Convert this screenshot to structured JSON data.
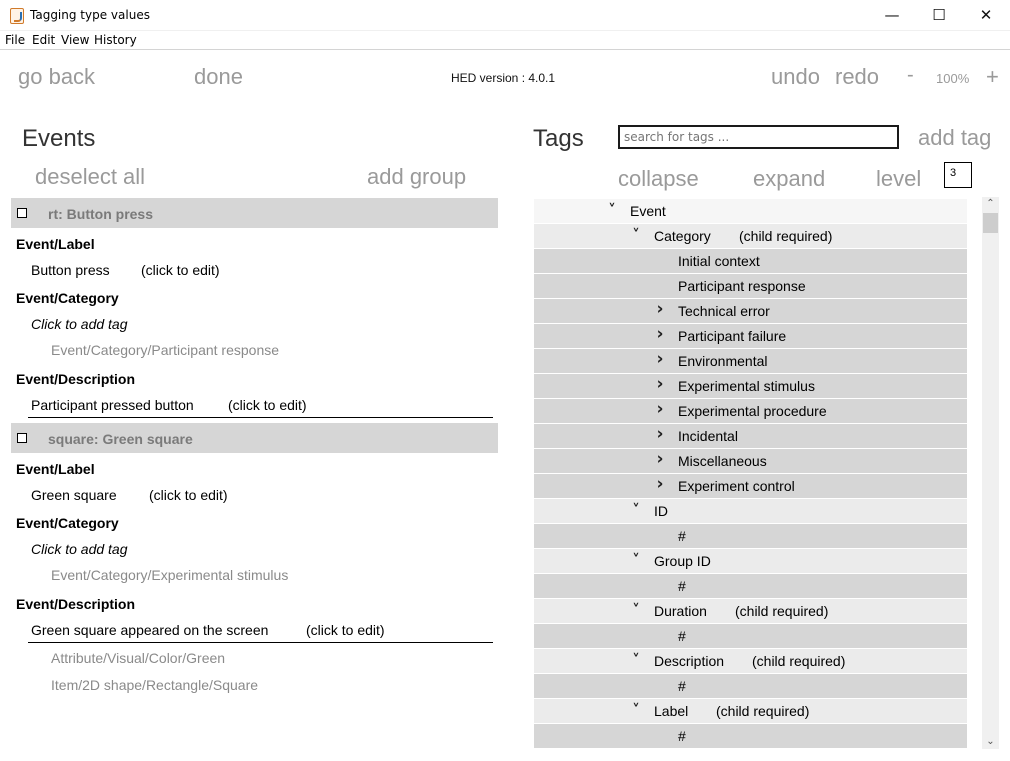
{
  "window": {
    "title": "Tagging type values",
    "minimize_glyph": "—",
    "maximize_glyph": "☐",
    "close_glyph": "✕"
  },
  "menu": [
    "File",
    "Edit",
    "View",
    "History"
  ],
  "toolbar": {
    "go_back": "go back",
    "done": "done",
    "hed_version": "HED version : 4.0.1",
    "undo": "undo",
    "redo": "redo",
    "zoom_out": "-",
    "zoom_level": "100%",
    "zoom_in": "+"
  },
  "events": {
    "title": "Events",
    "deselect_all": "deselect all",
    "add_group": "add group",
    "items": [
      {
        "title": "rt: Button press",
        "label_heading": "Event/Label",
        "label_value": "Button press",
        "label_edit": "(click to edit)",
        "category_heading": "Event/Category",
        "add_tag": "Click to add tag",
        "category_tags": [
          "Event/Category/Participant response"
        ],
        "description_heading": "Event/Description",
        "description_value": "Participant pressed button",
        "description_edit": "(click to edit)",
        "extra_tags": []
      },
      {
        "title": "square: Green square",
        "label_heading": "Event/Label",
        "label_value": "Green square",
        "label_edit": "(click to edit)",
        "category_heading": "Event/Category",
        "add_tag": "Click to add tag",
        "category_tags": [
          "Event/Category/Experimental stimulus"
        ],
        "description_heading": "Event/Description",
        "description_value": "Green square appeared on the screen",
        "description_edit": "(click to edit)",
        "extra_tags": [
          "Attribute/Visual/Color/Green",
          "Item/2D shape/Rectangle/Square"
        ]
      }
    ]
  },
  "tags": {
    "title": "Tags",
    "search_placeholder": "search for tags ...",
    "add_tag": "add tag",
    "collapse": "collapse",
    "expand": "expand",
    "level_label": "level",
    "level_value": "3",
    "tree": [
      {
        "label": "Event",
        "depth": 0,
        "chevron": "down",
        "note": ""
      },
      {
        "label": "Category",
        "depth": 1,
        "chevron": "down",
        "note": "(child required)"
      },
      {
        "label": "Initial context",
        "depth": 2,
        "chevron": "none",
        "note": ""
      },
      {
        "label": "Participant response",
        "depth": 2,
        "chevron": "none",
        "note": ""
      },
      {
        "label": "Technical error",
        "depth": 2,
        "chevron": "right",
        "note": ""
      },
      {
        "label": "Participant failure",
        "depth": 2,
        "chevron": "right",
        "note": ""
      },
      {
        "label": "Environmental",
        "depth": 2,
        "chevron": "right",
        "note": ""
      },
      {
        "label": "Experimental stimulus",
        "depth": 2,
        "chevron": "right",
        "note": ""
      },
      {
        "label": "Experimental procedure",
        "depth": 2,
        "chevron": "right",
        "note": ""
      },
      {
        "label": "Incidental",
        "depth": 2,
        "chevron": "right",
        "note": ""
      },
      {
        "label": "Miscellaneous",
        "depth": 2,
        "chevron": "right",
        "note": ""
      },
      {
        "label": "Experiment control",
        "depth": 2,
        "chevron": "right",
        "note": ""
      },
      {
        "label": "ID",
        "depth": 1,
        "chevron": "down",
        "note": ""
      },
      {
        "label": "#",
        "depth": 2,
        "chevron": "none",
        "note": ""
      },
      {
        "label": "Group ID",
        "depth": 1,
        "chevron": "down",
        "note": ""
      },
      {
        "label": "#",
        "depth": 2,
        "chevron": "none",
        "note": ""
      },
      {
        "label": "Duration",
        "depth": 1,
        "chevron": "down",
        "note": "(child required)"
      },
      {
        "label": "#",
        "depth": 2,
        "chevron": "none",
        "note": ""
      },
      {
        "label": "Description",
        "depth": 1,
        "chevron": "down",
        "note": "(child required)"
      },
      {
        "label": "#",
        "depth": 2,
        "chevron": "none",
        "note": ""
      },
      {
        "label": "Label",
        "depth": 1,
        "chevron": "down",
        "note": "(child required)"
      },
      {
        "label": "#",
        "depth": 2,
        "chevron": "none",
        "note": ""
      }
    ]
  },
  "colors": {
    "row_light": "#ebebeb",
    "row_dark": "#d6d6d6",
    "action_text": "#9a9a9a",
    "event_header_bg": "#d6d6d6",
    "tag_text": "#8a8a8a"
  }
}
